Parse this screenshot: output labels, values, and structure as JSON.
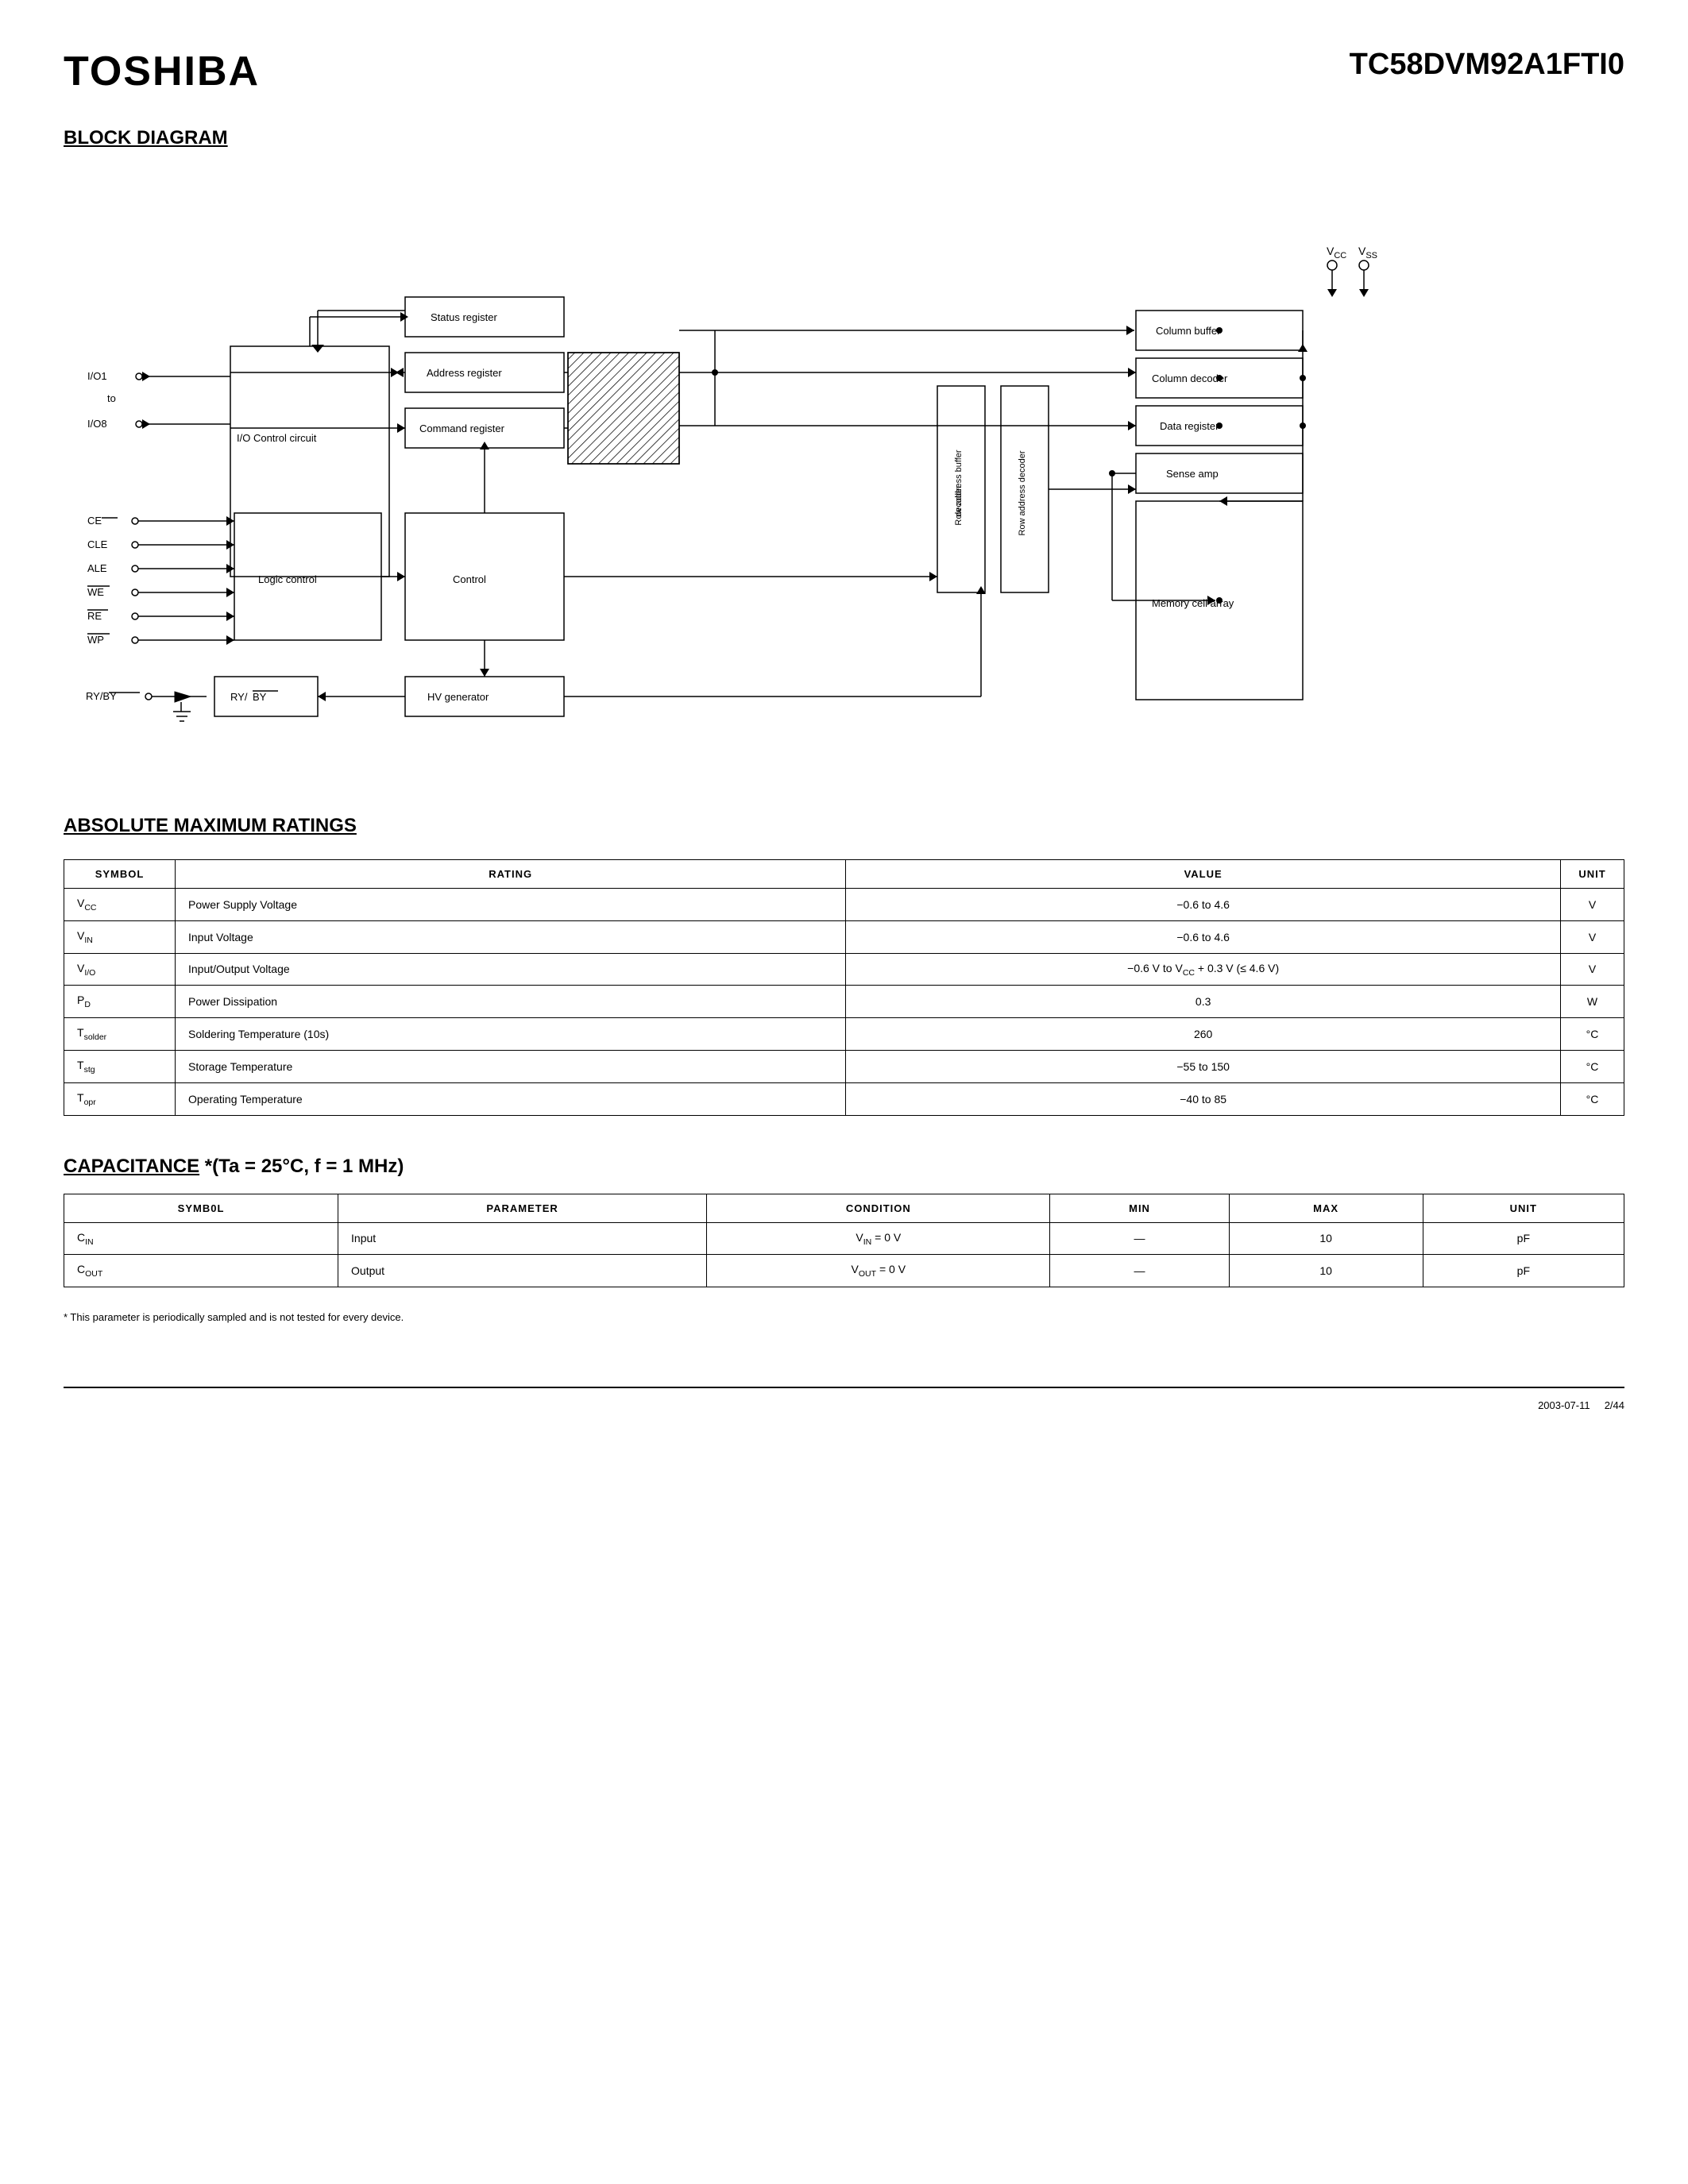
{
  "header": {
    "logo": "TOSHIBA",
    "part_number": "TC58DVM92A1FTI0"
  },
  "block_diagram": {
    "title": "BLOCK DIAGRAM"
  },
  "absolute_max": {
    "title": "ABSOLUTE MAXIMUM RATINGS",
    "columns": [
      "SYMBOL",
      "RATING",
      "VALUE",
      "UNIT"
    ],
    "rows": [
      {
        "symbol": "V_CC",
        "rating": "Power Supply Voltage",
        "value": "−0.6 to 4.6",
        "unit": "V"
      },
      {
        "symbol": "V_IN",
        "rating": "Input Voltage",
        "value": "−0.6 to 4.6",
        "unit": "V"
      },
      {
        "symbol": "V_I/O",
        "rating": "Input/Output Voltage",
        "value": "−0.6 V to V_CC + 0.3 V (≤ 4.6 V)",
        "unit": "V"
      },
      {
        "symbol": "P_D",
        "rating": "Power Dissipation",
        "value": "0.3",
        "unit": "W"
      },
      {
        "symbol": "T_solder",
        "rating": "Soldering Temperature (10s)",
        "value": "260",
        "unit": "°C"
      },
      {
        "symbol": "T_stg",
        "rating": "Storage Temperature",
        "value": "−55 to 150",
        "unit": "°C"
      },
      {
        "symbol": "T_opr",
        "rating": "Operating Temperature",
        "value": "−40 to 85",
        "unit": "°C"
      }
    ]
  },
  "capacitance": {
    "title_plain": "CAPACITANCE",
    "title_condition": "*(Ta = 25°C, f = 1 MHz)",
    "columns": [
      "SYMB0L",
      "PARAMETER",
      "CONDITION",
      "MIN",
      "MAX",
      "UNIT"
    ],
    "rows": [
      {
        "symbol": "C_IN",
        "parameter": "Input",
        "condition": "V_IN = 0 V",
        "min": "—",
        "max": "10",
        "unit": "pF"
      },
      {
        "symbol": "C_OUT",
        "parameter": "Output",
        "condition": "V_OUT = 0 V",
        "min": "—",
        "max": "10",
        "unit": "pF"
      }
    ],
    "footnote": "* This parameter is periodically sampled and is not tested for every device."
  },
  "footer": {
    "date": "2003-07-11",
    "page": "2/44"
  }
}
